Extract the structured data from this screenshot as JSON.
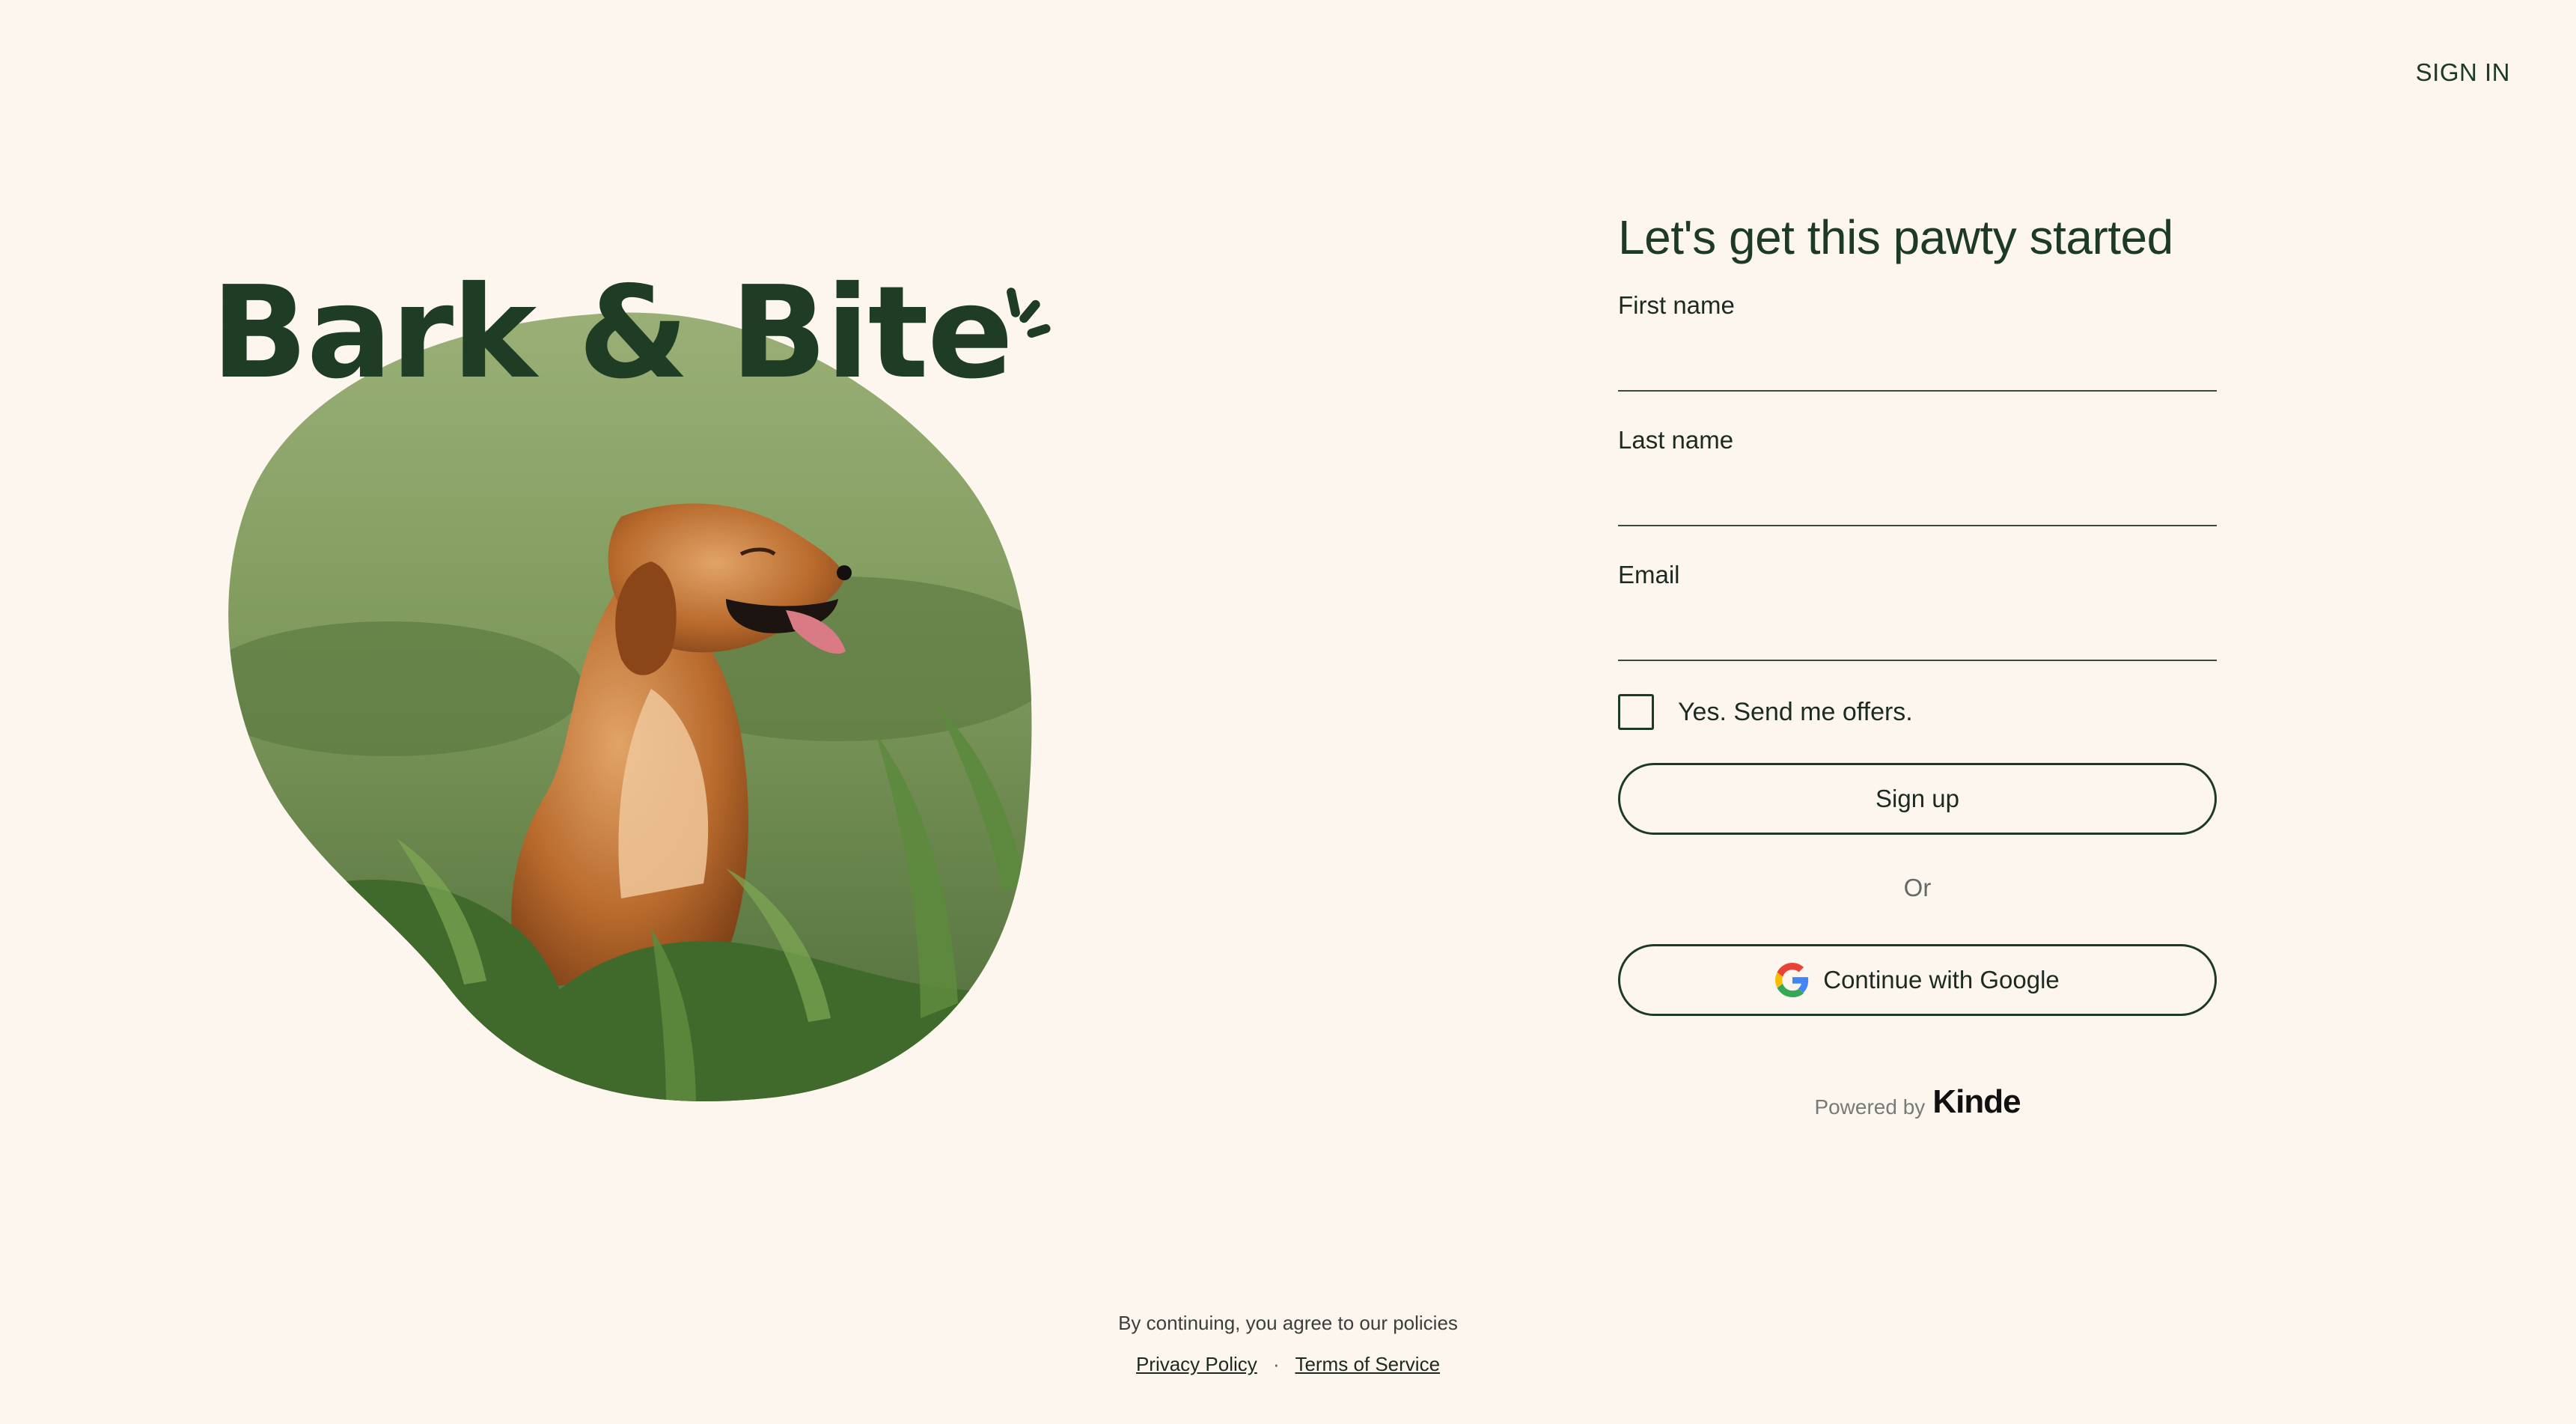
{
  "nav": {
    "sign_in": "SIGN IN"
  },
  "brand": {
    "name": "Bark & Bite",
    "color": "#1f3d24"
  },
  "form": {
    "heading": "Let's get this pawty started",
    "first_name_label": "First name",
    "first_name_value": "",
    "last_name_label": "Last name",
    "last_name_value": "",
    "email_label": "Email",
    "email_value": "",
    "offers_label": "Yes. Send me offers.",
    "offers_checked": false,
    "signup_button": "Sign up",
    "or_text": "Or",
    "google_button": "Continue with Google",
    "google_icon": "google-g-icon",
    "powered_by": "Powered by",
    "provider": "Kinde"
  },
  "footer": {
    "agree_text": "By continuing, you agree to our policies",
    "privacy": "Privacy Policy",
    "separator": "·",
    "terms": "Terms of Service"
  },
  "colors": {
    "background": "#fcf6ef",
    "accent": "#1d3a24"
  }
}
